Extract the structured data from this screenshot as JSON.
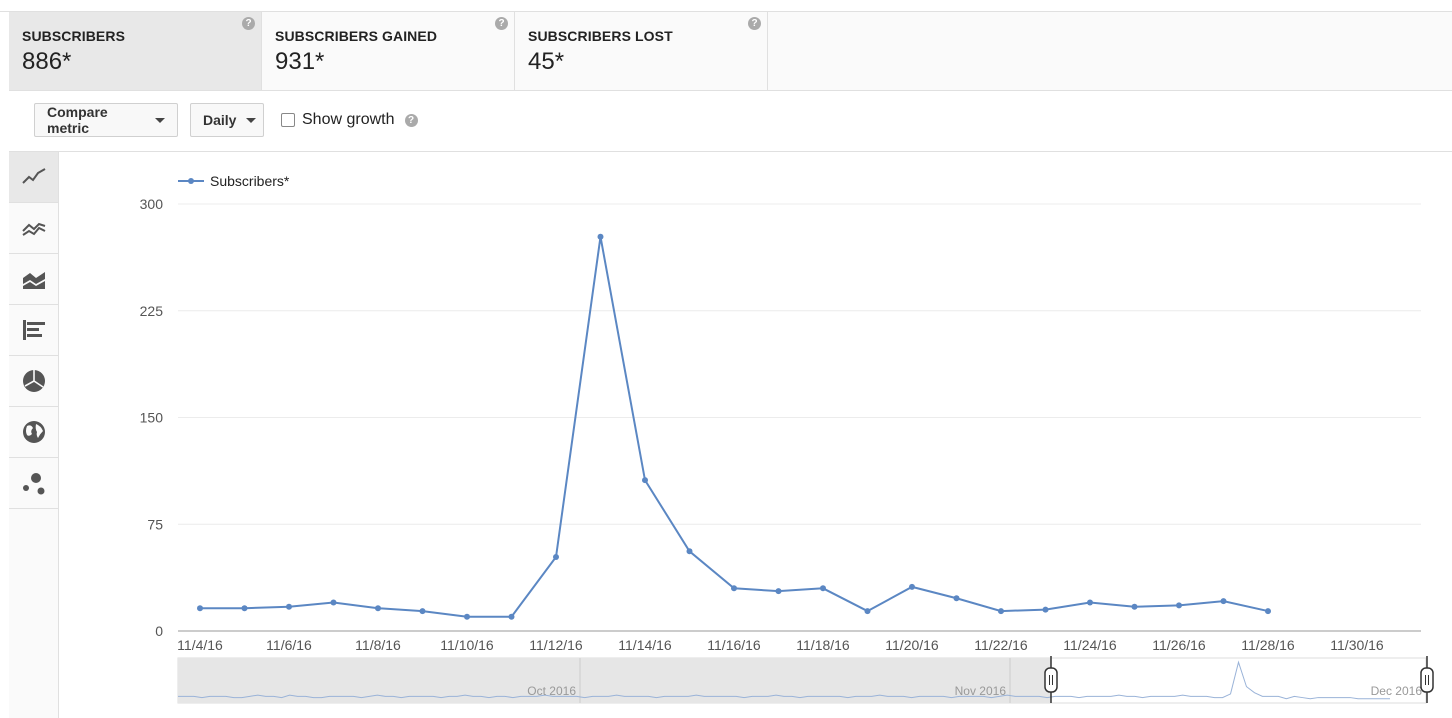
{
  "metrics": [
    {
      "label": "SUBSCRIBERS",
      "value": "886*",
      "active": true
    },
    {
      "label": "SUBSCRIBERS GAINED",
      "value": "931*",
      "active": false
    },
    {
      "label": "SUBSCRIBERS LOST",
      "value": "45*",
      "active": false
    }
  ],
  "toolbar": {
    "compare_label": "Compare metric",
    "interval_label": "Daily",
    "growth_label": "Show growth",
    "help_glyph": "?"
  },
  "sidebar": {
    "icons": [
      "line-chart-icon",
      "multi-line-chart-icon",
      "stacked-area-chart-icon",
      "bar-chart-icon",
      "pie-chart-icon",
      "globe-map-icon",
      "bubble-chart-icon"
    ]
  },
  "colors": {
    "series": "#5b87c3",
    "grid": "#ececec",
    "axis_text": "#555555",
    "navigator_shade": "#e6e6e6"
  },
  "chart_data": {
    "type": "line",
    "legend": "top-left",
    "grid": true,
    "ylim": [
      0,
      300
    ],
    "yticks": [
      "0",
      "75",
      "150",
      "225",
      "300"
    ],
    "xticks": [
      "11/4/16",
      "11/6/16",
      "11/8/16",
      "11/10/16",
      "11/12/16",
      "11/14/16",
      "11/16/16",
      "11/18/16",
      "11/20/16",
      "11/22/16",
      "11/24/16",
      "11/26/16",
      "11/28/16",
      "11/30/16"
    ],
    "x": [
      "11/4/16",
      "11/5/16",
      "11/6/16",
      "11/7/16",
      "11/8/16",
      "11/9/16",
      "11/10/16",
      "11/11/16",
      "11/12/16",
      "11/13/16",
      "11/14/16",
      "11/15/16",
      "11/16/16",
      "11/17/16",
      "11/18/16",
      "11/19/16",
      "11/20/16",
      "11/21/16",
      "11/22/16",
      "11/23/16",
      "11/24/16",
      "11/25/16",
      "11/26/16",
      "11/27/16",
      "11/28/16"
    ],
    "series": [
      {
        "name": "Subscribers*",
        "values": [
          16,
          16,
          17,
          20,
          16,
          14,
          10,
          10,
          52,
          277,
          106,
          56,
          30,
          28,
          30,
          14,
          31,
          23,
          14,
          15,
          20,
          17,
          18,
          21,
          14
        ]
      }
    ],
    "navigator": {
      "labels": [
        "Oct 2016",
        "Nov 2016",
        "Dec 2016"
      ],
      "series": [
        3,
        3,
        3,
        2,
        3,
        3,
        3,
        2,
        2,
        3,
        4,
        3,
        3,
        2,
        4,
        3,
        3,
        2,
        2,
        3,
        3,
        3,
        3,
        2,
        3,
        4,
        3,
        3,
        2,
        3,
        3,
        3,
        3,
        2,
        3,
        3,
        4,
        3,
        3,
        2,
        3,
        3,
        2,
        3,
        3,
        3,
        4,
        3,
        3,
        3,
        3,
        2,
        3,
        3,
        3,
        4,
        3,
        3,
        3,
        3,
        2,
        3,
        3,
        3,
        3,
        4,
        3,
        3,
        3,
        3,
        3,
        2,
        3,
        3,
        3,
        4,
        3,
        3,
        2,
        3,
        3,
        3,
        3,
        3,
        2,
        3,
        3,
        3,
        4,
        3,
        3,
        3,
        2,
        3,
        3,
        3,
        3,
        2,
        3,
        3,
        3,
        3,
        2,
        3,
        4,
        3,
        3,
        3,
        3,
        2,
        3,
        3,
        3,
        2,
        3,
        3,
        3,
        3,
        4,
        3,
        3,
        2,
        3,
        3,
        3,
        3,
        4,
        3,
        3,
        3,
        2,
        2,
        5,
        31,
        11,
        6,
        3,
        3,
        3,
        1,
        3,
        2,
        1,
        2,
        2,
        2,
        2,
        2,
        1,
        1,
        1,
        1,
        1
      ]
    }
  }
}
